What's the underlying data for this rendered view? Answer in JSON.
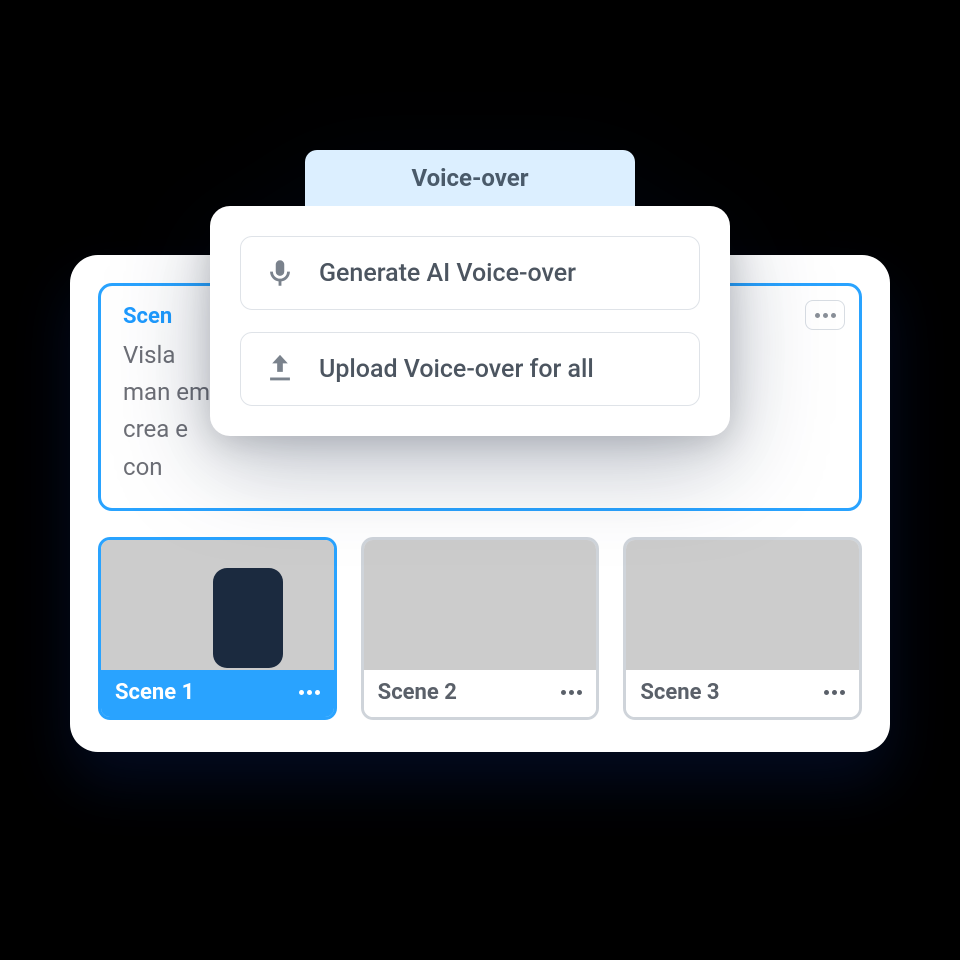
{
  "popover": {
    "tab_label": "Voice-over",
    "options": [
      {
        "icon": "microphone",
        "label": "Generate AI Voice-over"
      },
      {
        "icon": "upload",
        "label": "Upload Voice-over for all"
      }
    ]
  },
  "scene_panel": {
    "label_prefix": "Scen",
    "body_visible": "Visla\nman                                                                                     em\ncrea                                                                                       e\ncon"
  },
  "thumbnails": [
    {
      "label": "Scene 1",
      "active": true
    },
    {
      "label": "Scene 2",
      "active": false
    },
    {
      "label": "Scene 3",
      "active": false
    }
  ]
}
